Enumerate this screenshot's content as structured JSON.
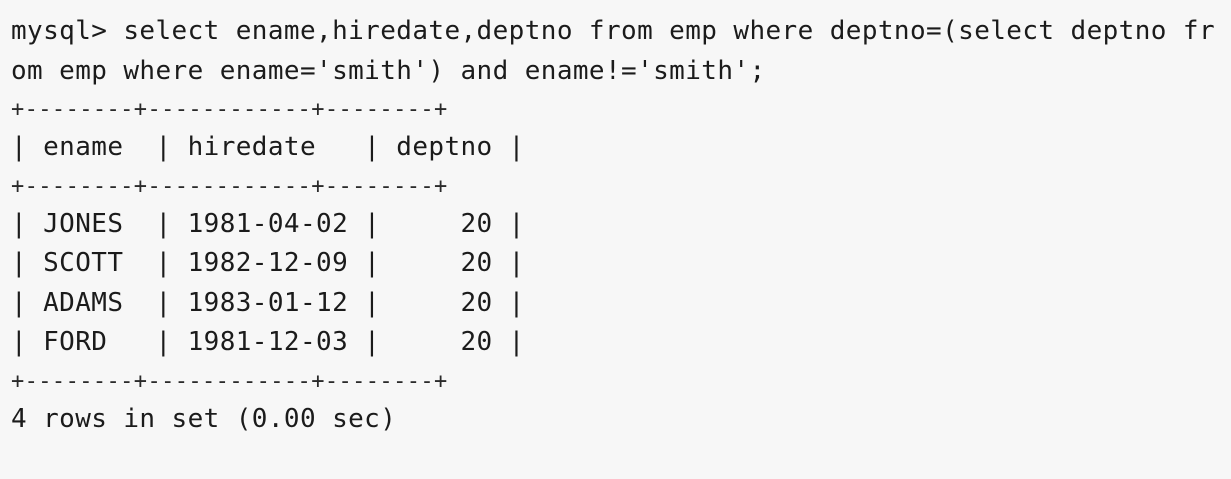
{
  "terminal": {
    "command": {
      "line1": "mysql> select ename,hiredate,deptno from emp where deptno=(select deptno fr",
      "line2": "om emp where ename='smith') and ename!='smith';"
    },
    "table": {
      "border": "+--------+------------+--------+",
      "header": "| ename  | hiredate   | deptno |",
      "rows": [
        "| JONES  | 1981-04-02 |     20 |",
        "| SCOTT  | 1982-12-09 |     20 |",
        "| ADAMS  | 1983-01-12 |     20 |",
        "| FORD   | 1981-12-03 |     20 |"
      ]
    },
    "result_summary": "4 rows in set (0.00 sec)"
  }
}
